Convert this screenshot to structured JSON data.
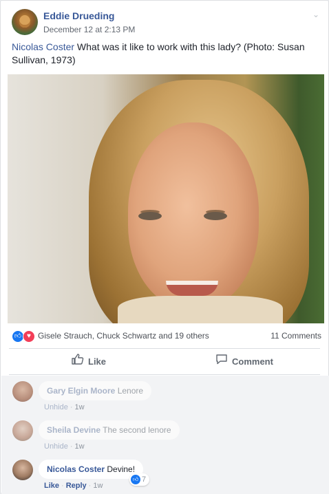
{
  "post": {
    "author": "Eddie Drueding",
    "timestamp": "December 12 at 2:13 PM",
    "mention": "Nicolas Coster",
    "text": " What was it like to work with this lady? (Photo: Susan Sullivan, 1973)"
  },
  "reactions": {
    "summary": "Gisele Strauch, Chuck Schwartz and 19 others",
    "comment_count": "11 Comments"
  },
  "actions": {
    "like_label": "Like",
    "comment_label": "Comment"
  },
  "comments": [
    {
      "author": "Gary Elgin Moore",
      "text": "Lenore",
      "unhide": "Unhide",
      "time": "1w"
    },
    {
      "author": "Sheila Devine",
      "text": "The second lenore",
      "unhide": "Unhide",
      "time": "1w"
    },
    {
      "author": "Nicolas Coster",
      "text": "Devine!",
      "like": "Like",
      "reply": "Reply",
      "time": "1w",
      "reaction_count": "7"
    }
  ],
  "colors": {
    "link": "#385898",
    "like_blue": "#1877f2",
    "love_red": "#f33e58"
  },
  "icons": {
    "like": "thumbs-up-icon",
    "comment": "speech-bubble-icon",
    "menu": "chevron-down-icon"
  }
}
